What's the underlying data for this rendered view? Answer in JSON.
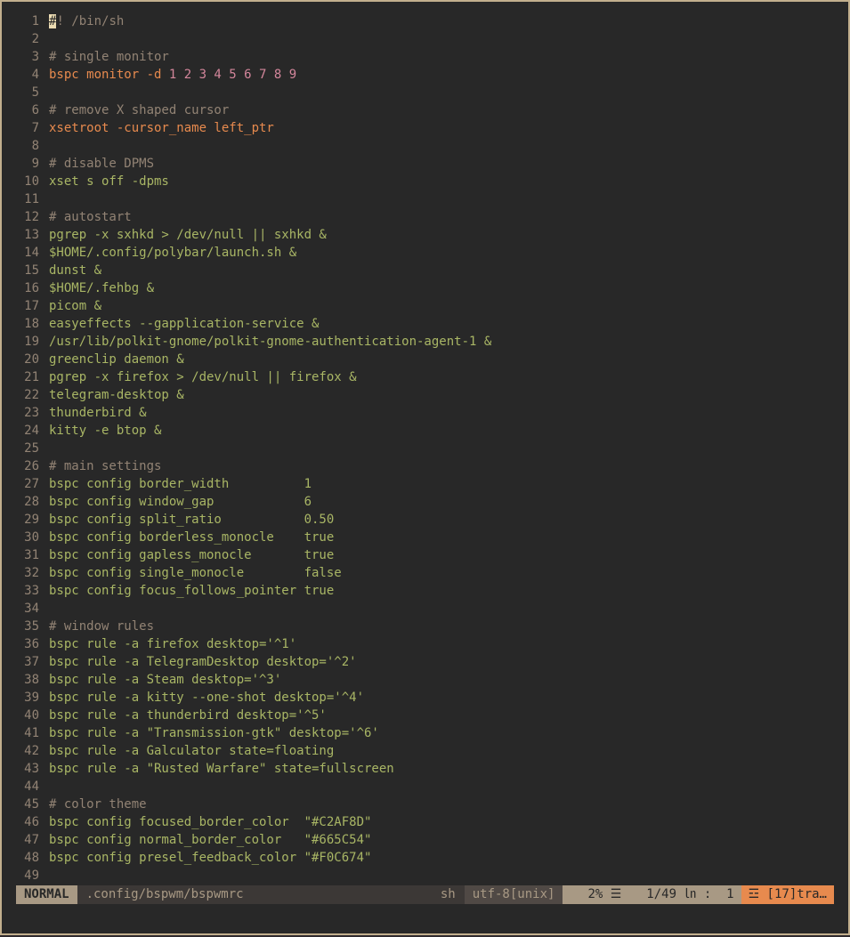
{
  "lines": [
    {
      "n": "1",
      "segs": [
        {
          "t": "#",
          "c": "cursor"
        },
        {
          "t": "! /bin/sh",
          "c": "comment"
        }
      ]
    },
    {
      "n": "2",
      "segs": []
    },
    {
      "n": "3",
      "segs": [
        {
          "t": "# single monitor",
          "c": "comment"
        }
      ]
    },
    {
      "n": "4",
      "segs": [
        {
          "t": "bspc monitor -d ",
          "c": "cmd"
        },
        {
          "t": "1 2 3 4 5 6 7 8 9",
          "c": "num"
        }
      ]
    },
    {
      "n": "5",
      "segs": []
    },
    {
      "n": "6",
      "segs": [
        {
          "t": "# remove X shaped cursor",
          "c": "comment"
        }
      ]
    },
    {
      "n": "7",
      "segs": [
        {
          "t": "xsetroot -cursor_name left_ptr",
          "c": "cmd"
        }
      ]
    },
    {
      "n": "8",
      "segs": []
    },
    {
      "n": "9",
      "segs": [
        {
          "t": "# disable DPMS",
          "c": "comment"
        }
      ]
    },
    {
      "n": "10",
      "segs": [
        {
          "t": "xset s off -dpms",
          "c": "plain"
        }
      ]
    },
    {
      "n": "11",
      "segs": []
    },
    {
      "n": "12",
      "segs": [
        {
          "t": "# autostart",
          "c": "comment"
        }
      ]
    },
    {
      "n": "13",
      "segs": [
        {
          "t": "pgrep -x sxhkd > /dev/null || sxhkd &",
          "c": "plain"
        }
      ]
    },
    {
      "n": "14",
      "segs": [
        {
          "t": "$HOME/.config/polybar/launch.sh &",
          "c": "plain"
        }
      ]
    },
    {
      "n": "15",
      "segs": [
        {
          "t": "dunst &",
          "c": "plain"
        }
      ]
    },
    {
      "n": "16",
      "segs": [
        {
          "t": "$HOME/.fehbg &",
          "c": "plain"
        }
      ]
    },
    {
      "n": "17",
      "segs": [
        {
          "t": "picom &",
          "c": "plain"
        }
      ]
    },
    {
      "n": "18",
      "segs": [
        {
          "t": "easyeffects --gapplication-service &",
          "c": "plain"
        }
      ]
    },
    {
      "n": "19",
      "segs": [
        {
          "t": "/usr/lib/polkit-gnome/polkit-gnome-authentication-agent-1 &",
          "c": "plain"
        }
      ]
    },
    {
      "n": "20",
      "segs": [
        {
          "t": "greenclip daemon &",
          "c": "plain"
        }
      ]
    },
    {
      "n": "21",
      "segs": [
        {
          "t": "pgrep -x firefox > /dev/null || firefox &",
          "c": "plain"
        }
      ]
    },
    {
      "n": "22",
      "segs": [
        {
          "t": "telegram-desktop &",
          "c": "plain"
        }
      ]
    },
    {
      "n": "23",
      "segs": [
        {
          "t": "thunderbird &",
          "c": "plain"
        }
      ]
    },
    {
      "n": "24",
      "segs": [
        {
          "t": "kitty -e btop &",
          "c": "plain"
        }
      ]
    },
    {
      "n": "25",
      "segs": []
    },
    {
      "n": "26",
      "segs": [
        {
          "t": "# main settings",
          "c": "comment"
        }
      ]
    },
    {
      "n": "27",
      "segs": [
        {
          "t": "bspc config border_width          1",
          "c": "plain"
        }
      ]
    },
    {
      "n": "28",
      "segs": [
        {
          "t": "bspc config window_gap            6",
          "c": "plain"
        }
      ]
    },
    {
      "n": "29",
      "segs": [
        {
          "t": "bspc config split_ratio           0.50",
          "c": "plain"
        }
      ]
    },
    {
      "n": "30",
      "segs": [
        {
          "t": "bspc config borderless_monocle    true",
          "c": "plain"
        }
      ]
    },
    {
      "n": "31",
      "segs": [
        {
          "t": "bspc config gapless_monocle       true",
          "c": "plain"
        }
      ]
    },
    {
      "n": "32",
      "segs": [
        {
          "t": "bspc config single_monocle        false",
          "c": "plain"
        }
      ]
    },
    {
      "n": "33",
      "segs": [
        {
          "t": "bspc config focus_follows_pointer true",
          "c": "plain"
        }
      ]
    },
    {
      "n": "34",
      "segs": []
    },
    {
      "n": "35",
      "segs": [
        {
          "t": "# window rules",
          "c": "comment"
        }
      ]
    },
    {
      "n": "36",
      "segs": [
        {
          "t": "bspc rule -a firefox desktop='^1'",
          "c": "plain"
        }
      ]
    },
    {
      "n": "37",
      "segs": [
        {
          "t": "bspc rule -a TelegramDesktop desktop='^2'",
          "c": "plain"
        }
      ]
    },
    {
      "n": "38",
      "segs": [
        {
          "t": "bspc rule -a Steam desktop='^3'",
          "c": "plain"
        }
      ]
    },
    {
      "n": "39",
      "segs": [
        {
          "t": "bspc rule -a kitty --one-shot desktop='^4'",
          "c": "plain"
        }
      ]
    },
    {
      "n": "40",
      "segs": [
        {
          "t": "bspc rule -a thunderbird desktop='^5'",
          "c": "plain"
        }
      ]
    },
    {
      "n": "41",
      "segs": [
        {
          "t": "bspc rule -a \"Transmission-gtk\" desktop='^6'",
          "c": "plain"
        }
      ]
    },
    {
      "n": "42",
      "segs": [
        {
          "t": "bspc rule -a Galculator state=floating",
          "c": "plain"
        }
      ]
    },
    {
      "n": "43",
      "segs": [
        {
          "t": "bspc rule -a \"Rusted Warfare\" state=fullscreen",
          "c": "plain"
        }
      ]
    },
    {
      "n": "44",
      "segs": []
    },
    {
      "n": "45",
      "segs": [
        {
          "t": "# color theme",
          "c": "comment"
        }
      ]
    },
    {
      "n": "46",
      "segs": [
        {
          "t": "bspc config focused_border_color  \"#C2AF8D\"",
          "c": "plain"
        }
      ]
    },
    {
      "n": "47",
      "segs": [
        {
          "t": "bspc config normal_border_color   \"#665C54\"",
          "c": "plain"
        }
      ]
    },
    {
      "n": "48",
      "segs": [
        {
          "t": "bspc config presel_feedback_color \"#F0C674\"",
          "c": "plain"
        }
      ]
    },
    {
      "n": "49",
      "segs": []
    }
  ],
  "status": {
    "mode": "NORMAL",
    "file": ".config/bspwm/bspwmrc",
    "filetype": "sh",
    "encoding": "utf-8[unix]",
    "percent": "2% ☰",
    "position": "1/49 ㏑ :  1",
    "warning": "☲ [17]tra…"
  },
  "colors": {
    "border": "#c2af8d",
    "background": "#282828",
    "comment": "#928374",
    "command": "#e78a4e",
    "string": "#a9b665",
    "number": "#d3869b"
  }
}
